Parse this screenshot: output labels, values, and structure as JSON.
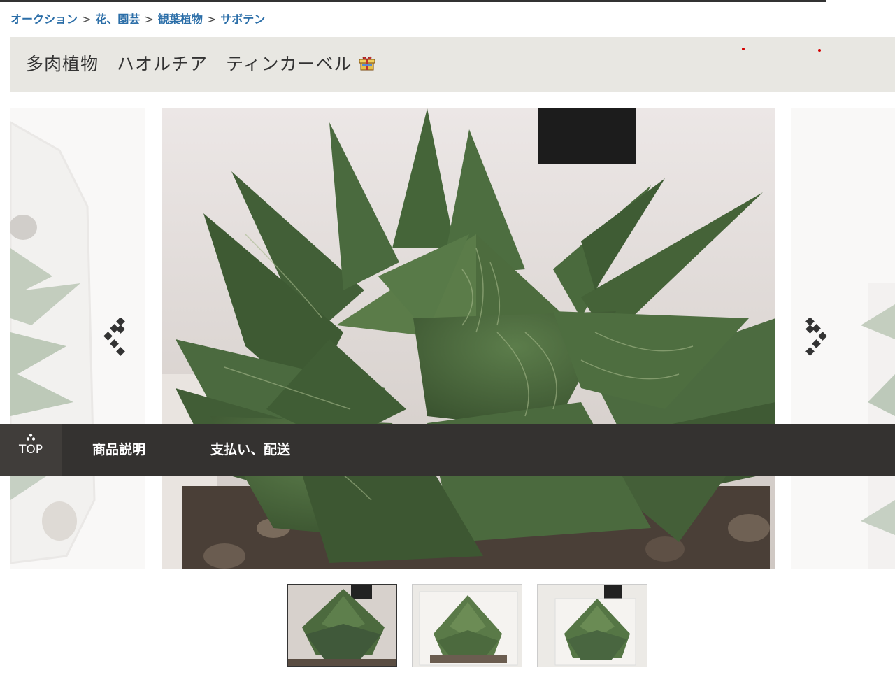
{
  "breadcrumb": {
    "items": [
      "オークション",
      "花、園芸",
      "観葉植物",
      "サボテン"
    ],
    "separator": ">"
  },
  "title": {
    "text": "多肉植物　ハオルチア　ティンカーベル",
    "icon": "gift-box-icon"
  },
  "carousel": {
    "prev_icon": "chevron-left-icon",
    "next_icon": "chevron-right-icon",
    "thumbnail_count": 3,
    "active_thumbnail": 1
  },
  "stickynav": {
    "top_label": "TOP",
    "description_label": "商品説明",
    "payment_label": "支払い、配送"
  },
  "colors": {
    "link": "#2b6ea8",
    "title_bar": "#e8e7e2",
    "nav_bg": "#343230",
    "plant_green": "#4b6b3e"
  }
}
